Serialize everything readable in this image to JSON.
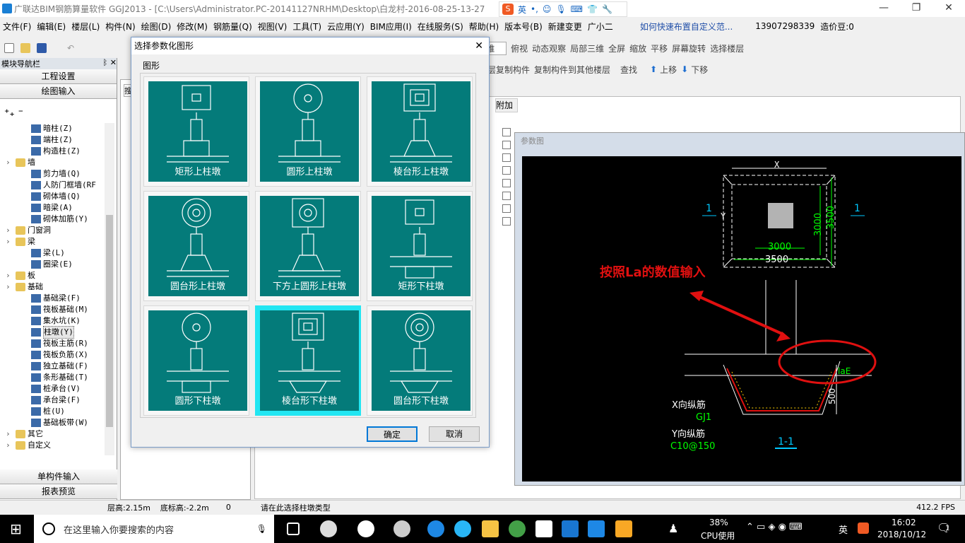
{
  "window": {
    "title": "广联达BIM钢筋算量软件 GGJ2013 - [C:\\Users\\Administrator.PC-20141127NRHM\\Desktop\\白龙村-2016-08-25-13-27",
    "controls": [
      "—",
      "❐",
      "✕"
    ]
  },
  "menu": [
    "文件(F)",
    "编辑(E)",
    "楼层(L)",
    "构件(N)",
    "绘图(D)",
    "修改(M)",
    "钢筋量(Q)",
    "视图(V)",
    "工具(T)",
    "云应用(Y)",
    "BIM应用(I)",
    "在线服务(S)",
    "帮助(H)",
    "版本号(B)",
    "新建变更",
    "广小二"
  ],
  "menu_right": {
    "link": "如何快速布置自定义范...",
    "phone": "13907298339",
    "beans": "造价豆:0"
  },
  "toolbar1": [
    "二维",
    "俯视",
    "动态观察",
    "局部三维",
    "全屏",
    "缩放",
    "平移",
    "屏幕旋转",
    "选择楼层"
  ],
  "toolbar2": [
    "层复制构件",
    "复制构件到其他楼层",
    "查找",
    "上移",
    "下移"
  ],
  "leftpanel": {
    "header": "模块导航栏",
    "pin": "ᛒ ✕",
    "buttons": [
      "工程设置",
      "绘图输入"
    ],
    "bottom_buttons": [
      "单构件输入",
      "报表预览"
    ],
    "tree": [
      {
        "label": "暗柱(Z)",
        "type": "leaf"
      },
      {
        "label": "端柱(Z)",
        "type": "leaf"
      },
      {
        "label": "构造柱(Z)",
        "type": "leaf"
      },
      {
        "label": "墙",
        "type": "folder"
      },
      {
        "label": "剪力墙(Q)",
        "type": "leaf"
      },
      {
        "label": "人防门框墙(RF",
        "type": "leaf"
      },
      {
        "label": "砌体墙(Q)",
        "type": "leaf"
      },
      {
        "label": "暗梁(A)",
        "type": "leaf"
      },
      {
        "label": "砌体加筋(Y)",
        "type": "leaf"
      },
      {
        "label": "门窗洞",
        "type": "folder"
      },
      {
        "label": "梁",
        "type": "folder"
      },
      {
        "label": "梁(L)",
        "type": "leaf"
      },
      {
        "label": "圈梁(E)",
        "type": "leaf"
      },
      {
        "label": "板",
        "type": "folder"
      },
      {
        "label": "基础",
        "type": "folder"
      },
      {
        "label": "基础梁(F)",
        "type": "leaf"
      },
      {
        "label": "筏板基础(M)",
        "type": "leaf"
      },
      {
        "label": "集水坑(K)",
        "type": "leaf"
      },
      {
        "label": "柱墩(Y)",
        "type": "leaf"
      },
      {
        "label": "筏板主筋(R)",
        "type": "leaf"
      },
      {
        "label": "筏板负筋(X)",
        "type": "leaf"
      },
      {
        "label": "独立基础(F)",
        "type": "leaf"
      },
      {
        "label": "条形基础(T)",
        "type": "leaf"
      },
      {
        "label": "桩承台(V)",
        "type": "leaf"
      },
      {
        "label": "承台梁(F)",
        "type": "leaf"
      },
      {
        "label": "桩(U)",
        "type": "leaf"
      },
      {
        "label": "基础板带(W)",
        "type": "leaf"
      },
      {
        "label": "其它",
        "type": "folder"
      },
      {
        "label": "自定义",
        "type": "folder"
      }
    ]
  },
  "mid": {
    "search": "搜"
  },
  "grid": {
    "col_header": "附加"
  },
  "dialog": {
    "title": "选择参数化图形",
    "close": "✕",
    "group_label": "图形",
    "items": [
      "矩形上柱墩",
      "圆形上柱墩",
      "棱台形上柱墩",
      "圆台形上柱墩",
      "下方上圆形上柱墩",
      "矩形下柱墩",
      "圆形下柱墩",
      "棱台形下柱墩",
      "圆台形下柱墩"
    ],
    "selected_index": 7,
    "ok": "确定",
    "cancel": "取消"
  },
  "param": {
    "title": "参数图",
    "labels": {
      "x": "X",
      "y": "Y",
      "sec1l": "1",
      "sec1r": "1",
      "d3000v": "3000",
      "d3500v": "3500",
      "d3000h": "3000",
      "d3500h": "3500",
      "annot": "按照La的数值输入",
      "lae": "laE",
      "d500": "500",
      "xbar": "X向纵筋",
      "gj": "GJ1",
      "ybar": "Y向纵筋",
      "stir": "C10@150",
      "sec": "1-1"
    },
    "colors": {
      "annot": "#e01010",
      "dim": "#00e000",
      "label": "#ffffff",
      "section": "#00c8ff"
    }
  },
  "status": {
    "floor_h": "层高:2.15m",
    "bottom": "底标高:-2.2m",
    "zero": "0",
    "hint": "请在此选择柱墩类型",
    "fps": "412.2 FPS"
  },
  "taskbar": {
    "search": "在这里输入你要搜索的内容",
    "cpu_pct": "38%",
    "cpu": "CPU使用",
    "ime": "英",
    "time": "16:02",
    "date": "2018/10/12",
    "notif": "1"
  }
}
